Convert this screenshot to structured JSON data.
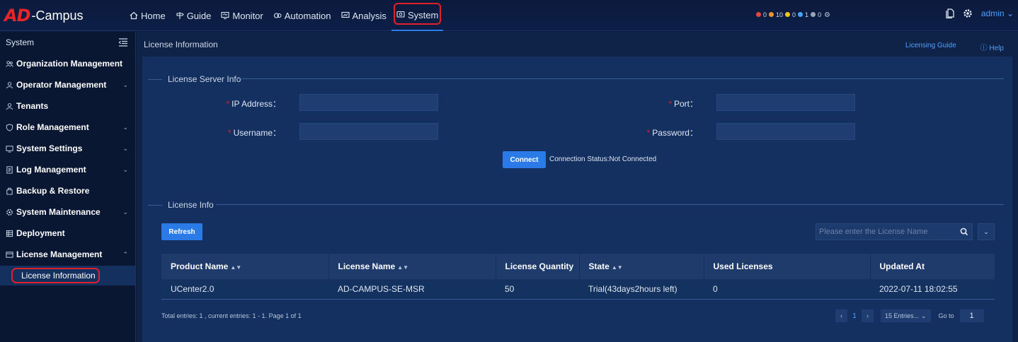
{
  "brand": {
    "logo_mark": "AD",
    "logo_text": "-Campus"
  },
  "nav": [
    {
      "label": "Home",
      "icon": "home-icon"
    },
    {
      "label": "Guide",
      "icon": "signpost-icon"
    },
    {
      "label": "Monitor",
      "icon": "monitor-icon"
    },
    {
      "label": "Automation",
      "icon": "automation-icon"
    },
    {
      "label": "Analysis",
      "icon": "analysis-icon"
    },
    {
      "label": "System",
      "icon": "system-icon",
      "active": true
    }
  ],
  "alarms": [
    {
      "count": "0",
      "color": "#e8453c"
    },
    {
      "count": "10",
      "color": "#f0932b"
    },
    {
      "count": "0",
      "color": "#f5c518"
    },
    {
      "count": "1",
      "color": "#3fa9f5"
    },
    {
      "count": "0",
      "color": "#9aa5b8"
    }
  ],
  "user": {
    "name": "admin"
  },
  "sidebar": {
    "title": "System",
    "items": [
      {
        "label": "Organization Management",
        "icon": "organization-icon",
        "expandable": false
      },
      {
        "label": "Operator Management",
        "icon": "operator-icon",
        "expandable": true
      },
      {
        "label": "Tenants",
        "icon": "tenant-icon",
        "expandable": false
      },
      {
        "label": "Role Management",
        "icon": "shield-icon",
        "expandable": true
      },
      {
        "label": "System Settings",
        "icon": "settings-icon",
        "expandable": true
      },
      {
        "label": "Log Management",
        "icon": "log-icon",
        "expandable": true
      },
      {
        "label": "Backup & Restore",
        "icon": "backup-icon",
        "expandable": false
      },
      {
        "label": "System Maintenance",
        "icon": "maintenance-icon",
        "expandable": true
      },
      {
        "label": "Deployment",
        "icon": "deployment-icon",
        "expandable": false
      },
      {
        "label": "License Management",
        "icon": "license-icon",
        "expandable": true,
        "expanded": true
      }
    ],
    "sub_item": "License Information"
  },
  "page": {
    "title": "License Information",
    "licensing_guide": "Licensing Guide",
    "help": "Help"
  },
  "server_info": {
    "section_title": "License Server Info",
    "ip_label": "IP Address：",
    "port_label": "Port：",
    "username_label": "Username：",
    "password_label": "Password：",
    "ip_value": "",
    "port_value": "",
    "username_value": "",
    "password_value": "",
    "connect_label": "Connect",
    "connection_status": "Connection Status:Not Connected"
  },
  "license_info": {
    "section_title": "License Info",
    "refresh_label": "Refresh",
    "search_placeholder": "Please enter the License Name",
    "columns": [
      "Product Name",
      "License Name",
      "License Quantity",
      "State",
      "Used Licenses",
      "Updated At"
    ],
    "rows": [
      [
        "UCenter2.0",
        "AD-CAMPUS-SE-MSR",
        "50",
        "Trial(43days2hours left)",
        "0",
        "2022-07-11 18:02:55"
      ]
    ],
    "footer": "Total entries: 1 , current entries: 1 - 1. Page 1 of 1",
    "current_page": "1",
    "page_size": "15 Entries...",
    "goto_label": "Go to",
    "goto_value": "1"
  }
}
